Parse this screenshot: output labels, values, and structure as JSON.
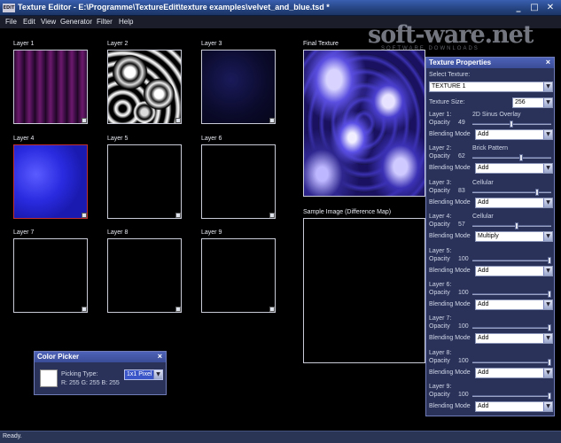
{
  "window": {
    "app_icon_text": "EDIT",
    "title": "Texture Editor - E:\\Programme\\TextureEdit\\texture examples\\velvet_and_blue.tsd *",
    "minimize": "_",
    "maximize": "□",
    "close": "✕"
  },
  "menu": [
    "File",
    "Edit",
    "View",
    "Generator",
    "Filter",
    "Help"
  ],
  "layers": [
    "Layer 1",
    "Layer 2",
    "Layer 3",
    "Layer 4",
    "Layer 5",
    "Layer 6",
    "Layer 7",
    "Layer 8",
    "Layer 9"
  ],
  "selected_layer": "Layer 4",
  "final_texture_label": "Final Texture",
  "sample_image_label": "Sample Image (Difference Map)",
  "watermark": {
    "text": "soft-ware.net",
    "sub": "SOFTWARE DOWNLOADS"
  },
  "properties": {
    "title": "Texture Properties",
    "close": "×",
    "select_texture_label": "Select Texture:",
    "texture_value": "TEXTURE 1",
    "texture_size_label": "Texture Size:",
    "texture_size_value": "256",
    "opacity_label": "Opacity",
    "blending_label": "Blending Mode",
    "layers": [
      {
        "name": "Layer 1:",
        "type": "2D Sinus Overlay",
        "opacity": "49",
        "blending": "Add"
      },
      {
        "name": "Layer 2:",
        "type": "Brick Pattern",
        "opacity": "62",
        "blending": "Add"
      },
      {
        "name": "Layer 3:",
        "type": "Cellular",
        "opacity": "83",
        "blending": "Add"
      },
      {
        "name": "Layer 4:",
        "type": "Cellular",
        "opacity": "57",
        "blending": "Multiply"
      },
      {
        "name": "Layer 5:",
        "type": "",
        "opacity": "100",
        "blending": "Add"
      },
      {
        "name": "Layer 6:",
        "type": "",
        "opacity": "100",
        "blending": "Add"
      },
      {
        "name": "Layer 7:",
        "type": "",
        "opacity": "100",
        "blending": "Add"
      },
      {
        "name": "Layer 8:",
        "type": "",
        "opacity": "100",
        "blending": "Add"
      },
      {
        "name": "Layer 9:",
        "type": "",
        "opacity": "100",
        "blending": "Add"
      }
    ]
  },
  "color_picker": {
    "title": "Color Picker",
    "close": "×",
    "picking_type_label": "Picking Type:",
    "picking_type_value": "1x1 Pixel",
    "rgb": "R: 255 G: 255 B: 255",
    "color": "#ffffff"
  },
  "status": "Ready."
}
